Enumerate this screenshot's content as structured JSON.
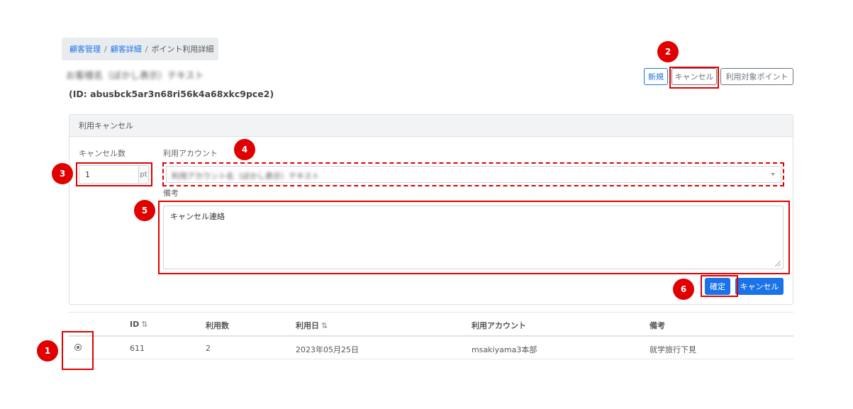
{
  "breadcrumb": {
    "items": [
      {
        "label": "顧客管理"
      },
      {
        "label": "顧客詳細"
      },
      {
        "label": "ポイント利用詳細"
      }
    ],
    "separator": "/"
  },
  "customer": {
    "name_blurred": "お客様名（ぼかし表示）テキスト",
    "id_text": "(ID: abusbck5ar3n68ri56k4a68xkc9pce2)"
  },
  "toolbar": {
    "new_label": "新規",
    "cancel_label": "キャンセル",
    "target_points_label": "利用対象ポイント"
  },
  "panel": {
    "title": "利用キャンセル",
    "cancel_count_label": "キャンセル数",
    "cancel_count_value": "1",
    "cancel_count_unit": "pt",
    "account_label": "利用アカウント",
    "account_value_blurred": "利用アカウント名（ぼかし表示）テキスト",
    "remark_label": "備考",
    "remark_value": "キャンセル連絡",
    "confirm_label": "確定",
    "cancel_label": "キャンセル"
  },
  "table": {
    "columns": [
      {
        "label": "ID",
        "sort_icon": "⇅"
      },
      {
        "label": "利用数"
      },
      {
        "label": "利用日",
        "sort_icon": "⇅"
      },
      {
        "label": "利用アカウント"
      },
      {
        "label": "備考"
      }
    ],
    "rows": [
      {
        "id": "611",
        "count": "2",
        "date": "2023年05月25日",
        "account": "msakiyama3本部",
        "remark": "就学旅行下見"
      }
    ]
  },
  "annotations": [
    {
      "label": "1"
    },
    {
      "label": "2"
    },
    {
      "label": "3"
    },
    {
      "label": "4"
    },
    {
      "label": "5"
    },
    {
      "label": "6"
    }
  ],
  "colors": {
    "accent": "#1a73e8",
    "annotation": "#e00000",
    "breadcrumb_bg": "#e9ecef",
    "panel_header_bg": "#f2f3f5"
  }
}
